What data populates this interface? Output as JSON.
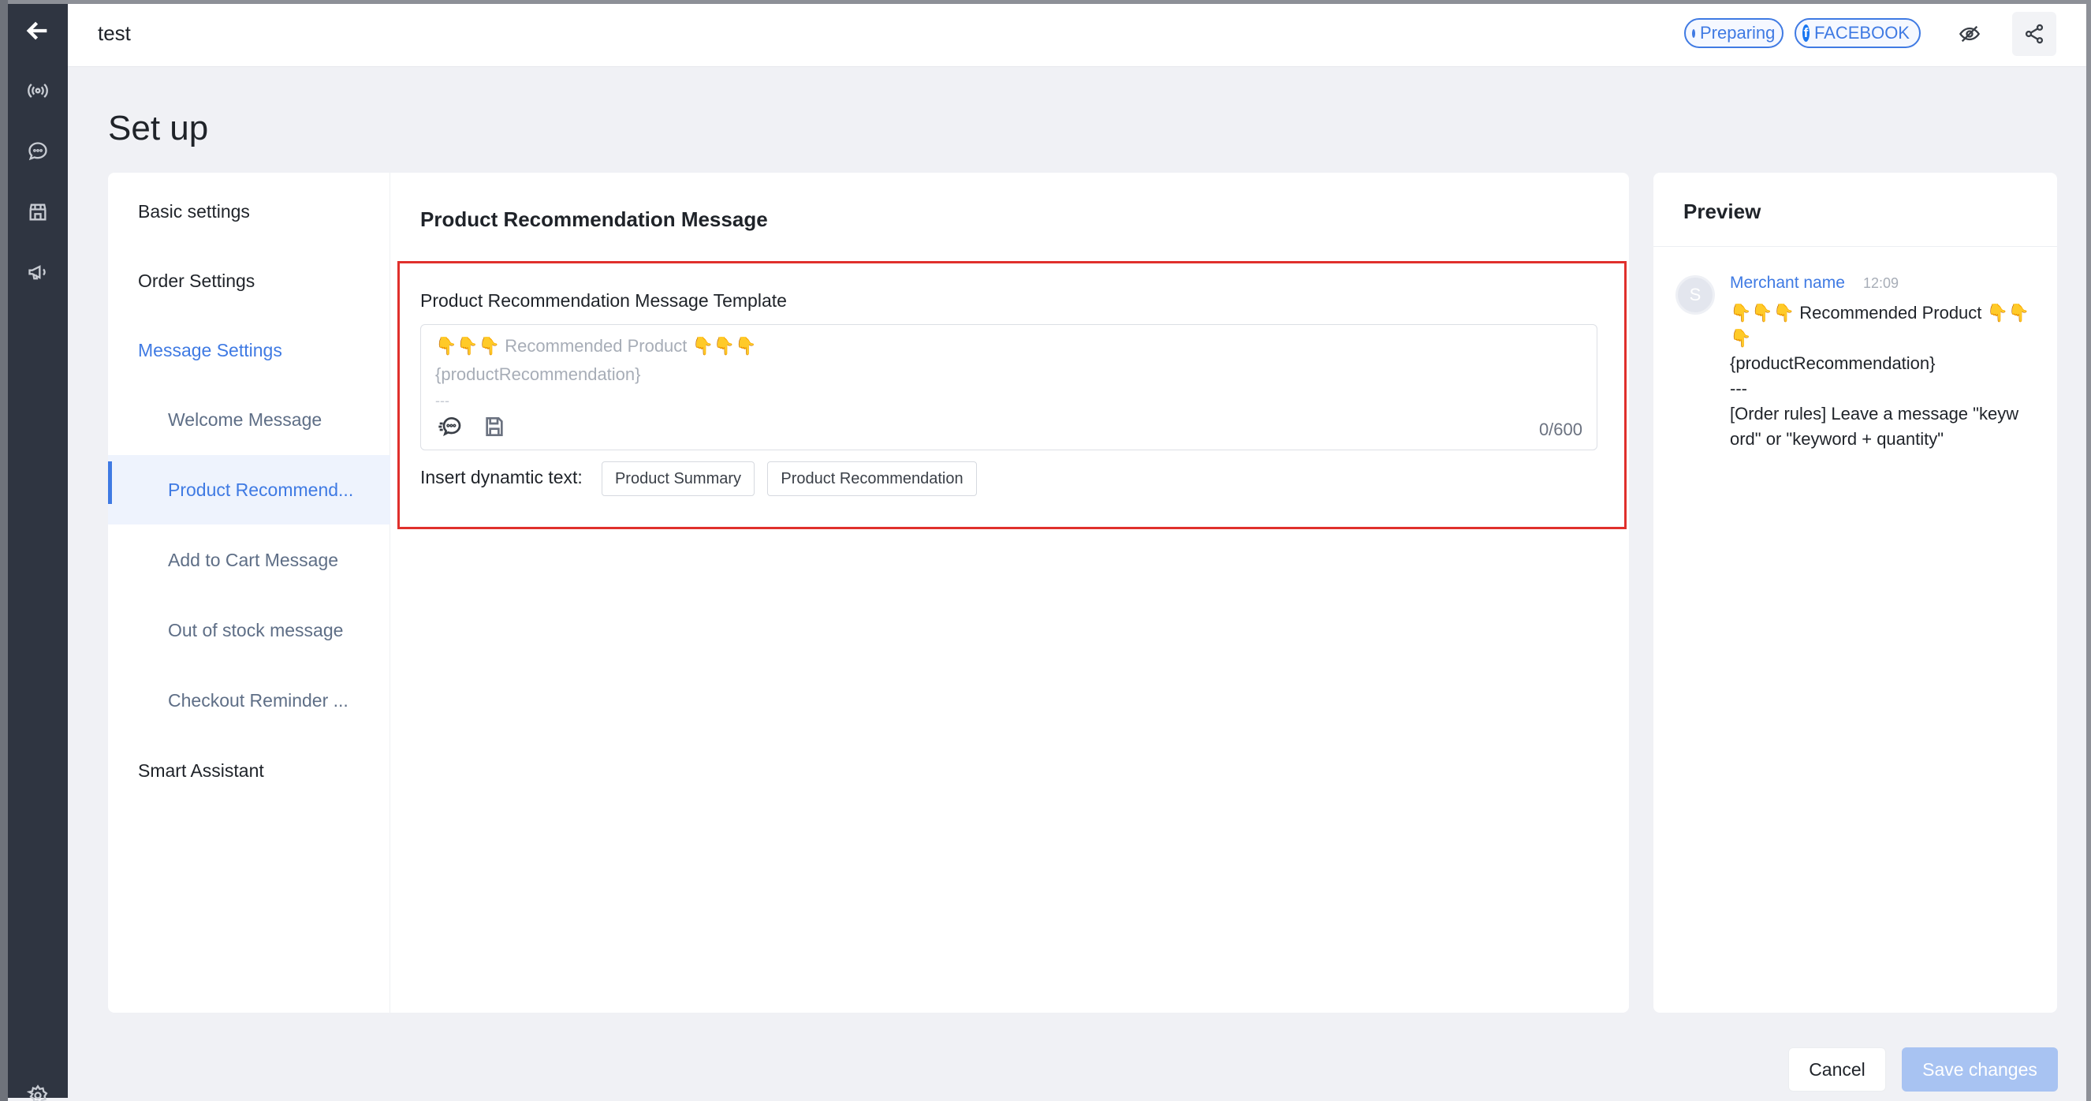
{
  "app": {
    "title": "test"
  },
  "status": {
    "preparing": "Preparing",
    "platform": "FACEBOOK"
  },
  "rail": {
    "icons": [
      "back-arrow-icon",
      "broadcast-icon",
      "chat-icon",
      "store-icon",
      "megaphone-icon",
      "gear-icon"
    ]
  },
  "page": {
    "title": "Set up"
  },
  "nav": {
    "items": [
      {
        "label": "Basic settings"
      },
      {
        "label": "Order Settings"
      },
      {
        "label": "Message Settings"
      },
      {
        "label": "Welcome Message"
      },
      {
        "label": "Product Recommend..."
      },
      {
        "label": "Add to Cart Message"
      },
      {
        "label": "Out of stock message"
      },
      {
        "label": "Checkout Reminder ..."
      },
      {
        "label": "Smart Assistant"
      }
    ],
    "active": "Product Recommend..."
  },
  "main": {
    "title": "Product Recommendation Message",
    "field_label": "Product Recommendation Message Template",
    "template_lines": [
      "👇👇👇 Recommended Product 👇👇👇",
      "{productRecommendation}",
      "---"
    ],
    "counter": "0/600",
    "dynamic_label": "Insert dynamtic text:",
    "dynamic_buttons": [
      "Product Summary",
      "Product Recommendation"
    ]
  },
  "preview": {
    "title": "Preview",
    "avatar_letter": "S",
    "merchant_name": "Merchant name",
    "time": "12:09",
    "message": "👇👇👇 Recommended Product 👇👇\n👇\n{productRecommendation}\n---\n[Order rules] Leave a message \"keyw\nord\" or \"keyword + quantity\""
  },
  "footer": {
    "cancel": "Cancel",
    "save": "Save changes"
  },
  "colors": {
    "accent": "#3f7ae3",
    "highlight_border": "#e0302c",
    "rail": "#2f3541",
    "save_disabled": "#a8c3f2"
  }
}
